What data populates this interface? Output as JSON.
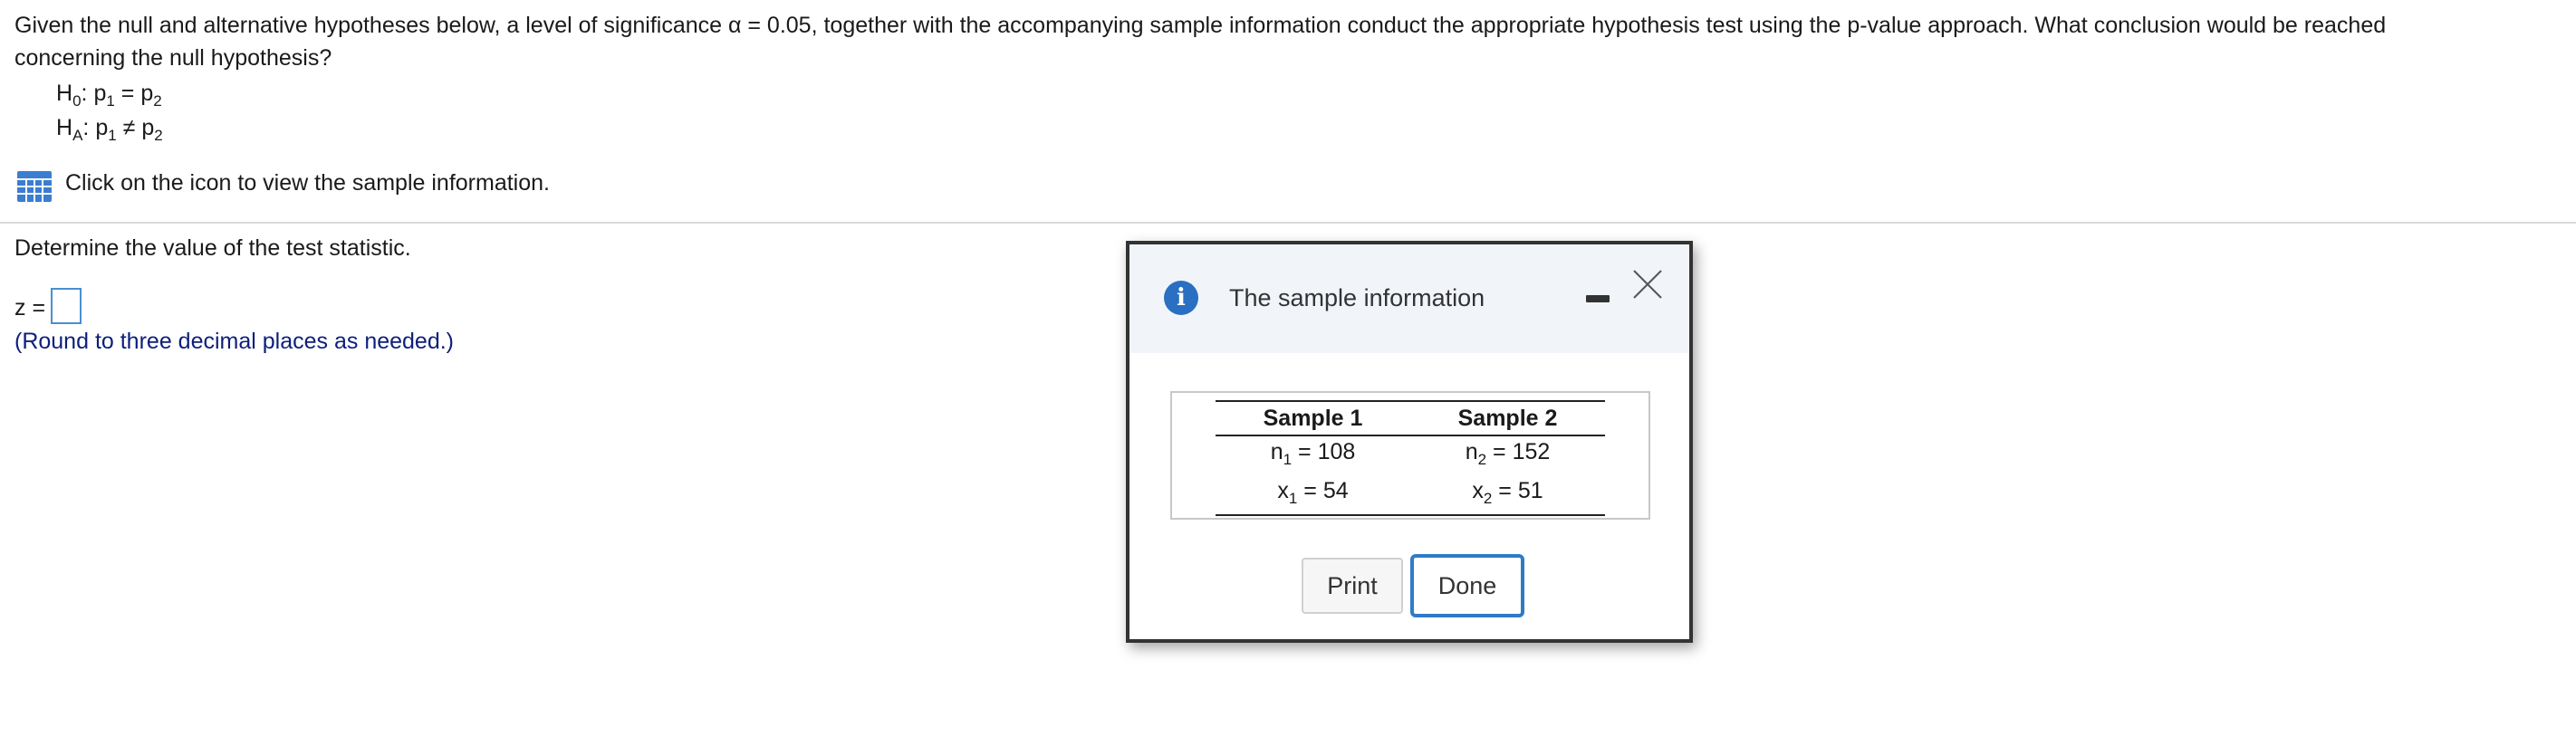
{
  "question": {
    "line1": "Given the null and alternative hypotheses below, a level of significance α = 0.05, together with the accompanying sample information conduct the appropriate hypothesis test using the p-value approach. What conclusion would be reached",
    "line2": "concerning the null hypothesis?"
  },
  "hypotheses": {
    "null": {
      "label": "H",
      "label_sub": "0",
      "colon": ":",
      "lhs": "p",
      "lhs_sub": "1",
      "op": "=",
      "rhs": "p",
      "rhs_sub": "2"
    },
    "alt": {
      "label": "H",
      "label_sub": "A",
      "colon": ":",
      "lhs": "p",
      "lhs_sub": "1",
      "op": "≠",
      "rhs": "p",
      "rhs_sub": "2"
    }
  },
  "sample_link": {
    "icon": "grid-table-icon",
    "text": "Click on the icon to view the sample information."
  },
  "answer": {
    "prompt": "Determine the value of the test statistic.",
    "z_label": "z =",
    "z_value": "",
    "hint": "(Round to three decimal places as needed.)"
  },
  "dialog": {
    "title": "The sample information",
    "icons": {
      "info": "info-icon",
      "minimize": "minimize-icon",
      "close": "close-icon"
    },
    "table": {
      "headers": [
        "Sample 1",
        "Sample 2"
      ],
      "rows": [
        [
          {
            "var": "n",
            "sub": "1",
            "rest": " = 108"
          },
          {
            "var": "n",
            "sub": "2",
            "rest": " = 152"
          }
        ],
        [
          {
            "var": "x",
            "sub": "1",
            "rest": " = 54"
          },
          {
            "var": "x",
            "sub": "2",
            "rest": " = 51"
          }
        ]
      ]
    },
    "buttons": {
      "print": "Print",
      "done": "Done"
    }
  },
  "colors": {
    "hint_text": "#0d1f7a",
    "accent_blue": "#2f7bc7",
    "info_icon": "#2a6fc1",
    "grid_icon": "#3b7ed0",
    "dialog_header_bg": "#f1f5fa"
  }
}
